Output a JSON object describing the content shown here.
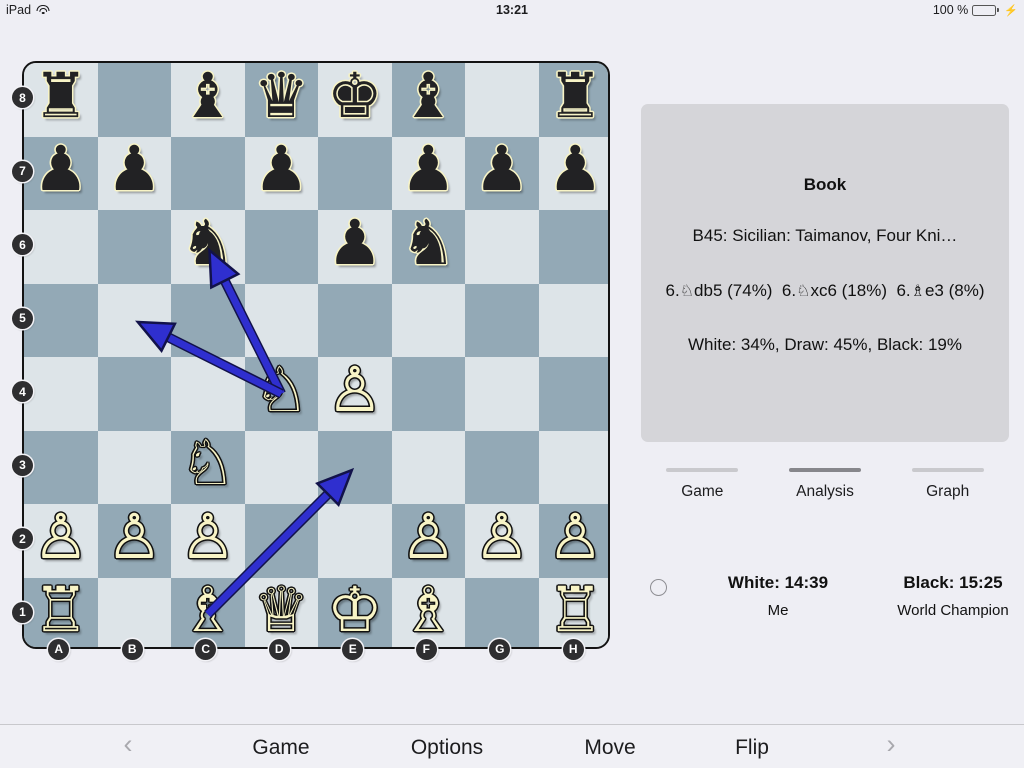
{
  "status_bar": {
    "carrier": "iPad",
    "wifi_icon": "wifi-icon",
    "time": "13:21",
    "battery_percent": "100 %",
    "battery_icon": "battery-icon",
    "charging_icon": "lightning-bolt-icon"
  },
  "board": {
    "file_labels": [
      "A",
      "B",
      "C",
      "D",
      "E",
      "F",
      "G",
      "H"
    ],
    "rank_labels": [
      "8",
      "7",
      "6",
      "5",
      "4",
      "3",
      "2",
      "1"
    ],
    "light_square_color": "#dde4e8",
    "dark_square_color": "#93a9b6",
    "white_piece_color": "#f8f4c6",
    "black_piece_color": "#222224",
    "arrow_color": "#2f2fcf",
    "pieces": [
      {
        "square": "a8",
        "color": "b",
        "type": "rook",
        "glyph": "♜"
      },
      {
        "square": "c8",
        "color": "b",
        "type": "bishop",
        "glyph": "♝"
      },
      {
        "square": "d8",
        "color": "b",
        "type": "queen",
        "glyph": "♛"
      },
      {
        "square": "e8",
        "color": "b",
        "type": "king",
        "glyph": "♚"
      },
      {
        "square": "f8",
        "color": "b",
        "type": "bishop",
        "glyph": "♝"
      },
      {
        "square": "h8",
        "color": "b",
        "type": "rook",
        "glyph": "♜"
      },
      {
        "square": "a7",
        "color": "b",
        "type": "pawn",
        "glyph": "♟"
      },
      {
        "square": "b7",
        "color": "b",
        "type": "pawn",
        "glyph": "♟"
      },
      {
        "square": "d7",
        "color": "b",
        "type": "pawn",
        "glyph": "♟"
      },
      {
        "square": "f7",
        "color": "b",
        "type": "pawn",
        "glyph": "♟"
      },
      {
        "square": "g7",
        "color": "b",
        "type": "pawn",
        "glyph": "♟"
      },
      {
        "square": "h7",
        "color": "b",
        "type": "pawn",
        "glyph": "♟"
      },
      {
        "square": "c6",
        "color": "b",
        "type": "knight",
        "glyph": "♞"
      },
      {
        "square": "e6",
        "color": "b",
        "type": "pawn",
        "glyph": "♟"
      },
      {
        "square": "f6",
        "color": "b",
        "type": "knight",
        "glyph": "♞"
      },
      {
        "square": "d4",
        "color": "w",
        "type": "knight",
        "glyph": "♘"
      },
      {
        "square": "e4",
        "color": "w",
        "type": "pawn",
        "glyph": "♙"
      },
      {
        "square": "c3",
        "color": "w",
        "type": "knight",
        "glyph": "♘"
      },
      {
        "square": "a2",
        "color": "w",
        "type": "pawn",
        "glyph": "♙"
      },
      {
        "square": "b2",
        "color": "w",
        "type": "pawn",
        "glyph": "♙"
      },
      {
        "square": "c2",
        "color": "w",
        "type": "pawn",
        "glyph": "♙"
      },
      {
        "square": "f2",
        "color": "w",
        "type": "pawn",
        "glyph": "♙"
      },
      {
        "square": "g2",
        "color": "w",
        "type": "pawn",
        "glyph": "♙"
      },
      {
        "square": "h2",
        "color": "w",
        "type": "pawn",
        "glyph": "♙"
      },
      {
        "square": "a1",
        "color": "w",
        "type": "rook",
        "glyph": "♖"
      },
      {
        "square": "c1",
        "color": "w",
        "type": "bishop",
        "glyph": "♗"
      },
      {
        "square": "d1",
        "color": "w",
        "type": "queen",
        "glyph": "♕"
      },
      {
        "square": "e1",
        "color": "w",
        "type": "king",
        "glyph": "♔"
      },
      {
        "square": "f1",
        "color": "w",
        "type": "bishop",
        "glyph": "♗"
      },
      {
        "square": "h1",
        "color": "w",
        "type": "rook",
        "glyph": "♖"
      }
    ],
    "arrows": [
      {
        "from": "d4",
        "to": "c6"
      },
      {
        "from": "d4",
        "to": "b5"
      },
      {
        "from": "c1",
        "to": "e3"
      }
    ]
  },
  "analysis": {
    "title": "Book",
    "opening": "B45: Sicilian: Taimanov, Four Kni…",
    "moves": [
      {
        "number": "6.",
        "piece_glyph": "♘",
        "move": "db5",
        "percent": "(74%)"
      },
      {
        "number": "6.",
        "piece_glyph": "♘",
        "move": "xc6",
        "percent": "(18%)"
      },
      {
        "number": "6.",
        "piece_glyph": "♗",
        "move": "e3",
        "percent": "(8%)"
      }
    ],
    "stats": "White: 34%, Draw: 45%, Black: 19%"
  },
  "tabs": [
    {
      "label": "Game",
      "selected": false
    },
    {
      "label": "Analysis",
      "selected": true
    },
    {
      "label": "Graph",
      "selected": false
    }
  ],
  "clocks": {
    "white_time": "White: 14:39",
    "white_player": "Me",
    "black_time": "Black: 15:25",
    "black_player": "World Champion"
  },
  "toolbar": {
    "prev_icon": "chevron-left-icon",
    "next_icon": "chevron-right-icon",
    "items": [
      "Game",
      "Options",
      "Move",
      "Flip"
    ]
  }
}
